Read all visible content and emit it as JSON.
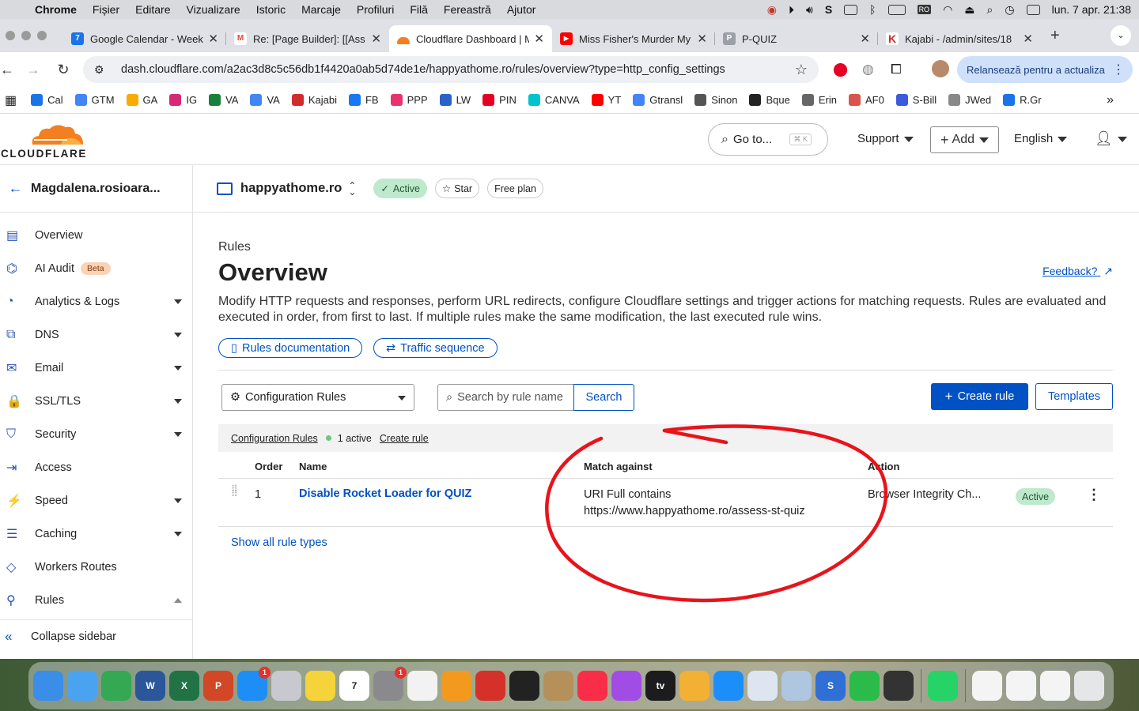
{
  "menubar": {
    "app": "Chrome",
    "items": [
      "Fișier",
      "Editare",
      "Vizualizare",
      "Istoric",
      "Marcaje",
      "Profiluri",
      "Filă",
      "Fereastră",
      "Ajutor"
    ],
    "input_source": "RO",
    "datetime": "lun. 7 apr.  21:38"
  },
  "tabs": [
    {
      "title": "Google Calendar - Week",
      "favicon_color": "#1a73e8",
      "favicon_text": "7"
    },
    {
      "title": "Re: [Page Builder]: [[Ass",
      "favicon_color": "#ea4335",
      "favicon_text": "M"
    },
    {
      "title": "Cloudflare Dashboard | M",
      "favicon_color": "#f38020",
      "favicon_text": ""
    },
    {
      "title": "Miss Fisher's Murder My",
      "favicon_color": "#ff0000",
      "favicon_text": "▶"
    },
    {
      "title": "P-QUIZ",
      "favicon_color": "#9aa0a6",
      "favicon_text": "P"
    },
    {
      "title": "Kajabi - /admin/sites/18",
      "favicon_color": "#d12c2c",
      "favicon_text": "K"
    }
  ],
  "address": {
    "url": "dash.cloudflare.com/a2ac3d8c5c56db1f4420a0ab5d74de1e/happyathome.ro/rules/overview?type=http_config_settings",
    "relaunch_label": "Relansează pentru a actualiza"
  },
  "bookmarks": [
    {
      "label": "Cal",
      "color": "#1a73e8"
    },
    {
      "label": "GTM",
      "color": "#4285f4"
    },
    {
      "label": "GA",
      "color": "#f9ab00"
    },
    {
      "label": "IG",
      "color": "#d62976"
    },
    {
      "label": "VA",
      "color": "#188038"
    },
    {
      "label": "VA",
      "color": "#4285f4"
    },
    {
      "label": "Kajabi",
      "color": "#d12c2c"
    },
    {
      "label": "FB",
      "color": "#1877f2"
    },
    {
      "label": "PPP",
      "color": "#e8336d"
    },
    {
      "label": "LW",
      "color": "#2a62c9"
    },
    {
      "label": "PIN",
      "color": "#e60023"
    },
    {
      "label": "CANVA",
      "color": "#00c4cc"
    },
    {
      "label": "YT",
      "color": "#ff0000"
    },
    {
      "label": "Gtransl",
      "color": "#4285f4"
    },
    {
      "label": "Sinon",
      "color": "#555555"
    },
    {
      "label": "Bque",
      "color": "#222222"
    },
    {
      "label": "Erin",
      "color": "#666666"
    },
    {
      "label": "AF0",
      "color": "#d9534f"
    },
    {
      "label": "S-Bill",
      "color": "#3b5bdb"
    },
    {
      "label": "JWed",
      "color": "#888888"
    },
    {
      "label": "R.Gr",
      "color": "#1a73e8"
    }
  ],
  "header": {
    "brand": "CLOUDFLARE",
    "goto_label": "Go to...",
    "goto_shortcut": "⌘ K",
    "support_label": "Support",
    "add_label": "Add",
    "language_label": "English"
  },
  "sidebar": {
    "account": "Magdalena.rosioara...",
    "items": [
      {
        "label": "Overview",
        "icon": "document-icon",
        "glyph": "▤",
        "expandable": false
      },
      {
        "label": "AI Audit",
        "icon": "robot-icon",
        "glyph": "⌬",
        "expandable": false,
        "badge": "Beta"
      },
      {
        "label": "Analytics & Logs",
        "icon": "chart-icon",
        "glyph": "◔",
        "expandable": true
      },
      {
        "label": "DNS",
        "icon": "network-icon",
        "glyph": "⧉",
        "expandable": true
      },
      {
        "label": "Email",
        "icon": "envelope-icon",
        "glyph": "✉",
        "expandable": true
      },
      {
        "label": "SSL/TLS",
        "icon": "lock-icon",
        "glyph": "🔒",
        "expandable": true
      },
      {
        "label": "Security",
        "icon": "shield-icon",
        "glyph": "⛉",
        "expandable": true
      },
      {
        "label": "Access",
        "icon": "login-icon",
        "glyph": "⇥",
        "expandable": false
      },
      {
        "label": "Speed",
        "icon": "lightning-icon",
        "glyph": "⚡",
        "expandable": true
      },
      {
        "label": "Caching",
        "icon": "server-icon",
        "glyph": "☰",
        "expandable": true
      },
      {
        "label": "Workers Routes",
        "icon": "workers-icon",
        "glyph": "◇",
        "expandable": false
      },
      {
        "label": "Rules",
        "icon": "rules-icon",
        "glyph": "⚲",
        "expandable": true,
        "expanded": true
      }
    ],
    "collapse_label": "Collapse sidebar"
  },
  "zone": {
    "name": "happyathome.ro",
    "status": "Active",
    "star_label": "Star",
    "plan": "Free plan"
  },
  "page": {
    "breadcrumb": "Rules",
    "title": "Overview",
    "feedback": "Feedback?",
    "description": "Modify HTTP requests and responses, perform URL redirects, configure Cloudflare settings and trigger actions for matching requests. Rules are evaluated and executed in order, from first to last. If multiple rules make the same modification, the last executed rule wins.",
    "docs_button": "Rules documentation",
    "sequence_button": "Traffic sequence"
  },
  "toolbar": {
    "rule_type": "Configuration Rules",
    "search_placeholder": "Search by rule name",
    "search_button": "Search",
    "create_button": "Create rule",
    "templates_button": "Templates"
  },
  "table": {
    "section_title": "Configuration Rules",
    "active_count": "1 active",
    "create_link": "Create rule",
    "columns": [
      "Order",
      "Name",
      "Match against",
      "Action"
    ],
    "rows": [
      {
        "order": "1",
        "name": "Disable Rocket Loader for QUIZ",
        "match_line1": "URI Full contains",
        "match_line2": "https://www.happyathome.ro/assess-st-quiz",
        "action": "Browser Integrity Ch...",
        "status": "Active"
      }
    ],
    "show_all": "Show all rule types"
  },
  "annotation": {
    "color": "#e8141b"
  },
  "dock": {
    "apps": [
      {
        "name": "finder-icon",
        "color": "#3b8ee8"
      },
      {
        "name": "mail-icon",
        "color": "#4aa3f0"
      },
      {
        "name": "chrome-icon",
        "color": "#34a853"
      },
      {
        "name": "word-icon",
        "color": "#2b579a",
        "text": "W"
      },
      {
        "name": "excel-icon",
        "color": "#217346",
        "text": "X"
      },
      {
        "name": "powerpoint-icon",
        "color": "#d24726",
        "text": "P"
      },
      {
        "name": "app-store-icon",
        "color": "#1e8ef7",
        "badge": "1"
      },
      {
        "name": "launchpad-icon",
        "color": "#c8c8d0"
      },
      {
        "name": "notes-icon",
        "color": "#f5d33a"
      },
      {
        "name": "calendar-icon",
        "color": "#ffffff",
        "text": "7",
        "dark": true
      },
      {
        "name": "settings-icon",
        "color": "#8a8a8e",
        "badge": "1"
      },
      {
        "name": "reminders-icon",
        "color": "#f2f2f2"
      },
      {
        "name": "books-icon",
        "color": "#f39a1e"
      },
      {
        "name": "pdf-icon",
        "color": "#d6302b"
      },
      {
        "name": "photo-booth-icon",
        "color": "#222222"
      },
      {
        "name": "contacts-icon",
        "color": "#b6905a"
      },
      {
        "name": "music-icon",
        "color": "#fa2d48"
      },
      {
        "name": "podcasts-icon",
        "color": "#a24ce6"
      },
      {
        "name": "tv-icon",
        "color": "#1c1c1e",
        "text": "tv"
      },
      {
        "name": "photos-icon",
        "color": "#f2b134"
      },
      {
        "name": "safari-icon",
        "color": "#1c8ef9"
      },
      {
        "name": "preview-icon",
        "color": "#dde6f0"
      },
      {
        "name": "preview2-icon",
        "color": "#aec6e0"
      },
      {
        "name": "s-app-icon",
        "color": "#2f6fd6",
        "text": "S"
      },
      {
        "name": "numbers-icon",
        "color": "#2bbb4a"
      },
      {
        "name": "quicktime-icon",
        "color": "#333333"
      },
      {
        "name": "whatsapp-icon",
        "color": "#25d366"
      },
      {
        "name": "document-thumb-icon",
        "color": "#f4f4f4"
      },
      {
        "name": "document-thumb-2-icon",
        "color": "#f4f4f4"
      },
      {
        "name": "document-thumb-3-icon",
        "color": "#f4f4f4"
      },
      {
        "name": "trash-icon",
        "color": "#e4e6e8"
      }
    ]
  }
}
